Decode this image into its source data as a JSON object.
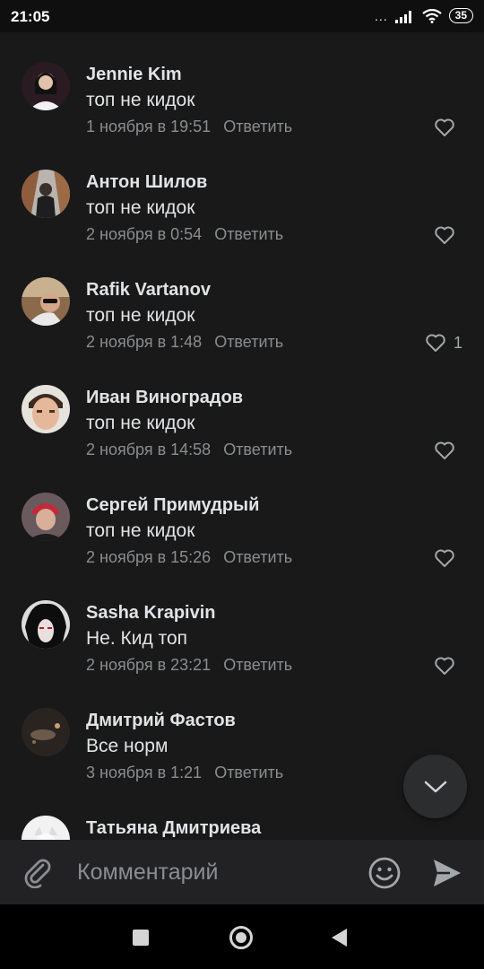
{
  "status_bar": {
    "time": "21:05",
    "signal_dots": "...",
    "battery": "35"
  },
  "comments": [
    {
      "author": "Jennie Kim",
      "text": "топ не кидок",
      "date": "1 ноября в 19:51",
      "reply": "Ответить",
      "likes": ""
    },
    {
      "author": "Антон Шилов",
      "text": "топ не кидок",
      "date": "2 ноября в 0:54",
      "reply": "Ответить",
      "likes": ""
    },
    {
      "author": "Rafik Vartanov",
      "text": "топ не кидок",
      "date": "2 ноября в 1:48",
      "reply": "Ответить",
      "likes": "1"
    },
    {
      "author": "Иван Виноградов",
      "text": "топ не кидок",
      "date": "2 ноября в 14:58",
      "reply": "Ответить",
      "likes": ""
    },
    {
      "author": "Сергей Примудрый",
      "text": "топ не кидок",
      "date": "2 ноября в 15:26",
      "reply": "Ответить",
      "likes": ""
    },
    {
      "author": "Sasha Krapivin",
      "text": "Не. Кид топ",
      "date": "2 ноября в 23:21",
      "reply": "Ответить",
      "likes": ""
    },
    {
      "author": "Дмитрий Фастов",
      "text": "Все норм",
      "date": "3 ноября в 1:21",
      "reply": "Ответить",
      "likes": ""
    },
    {
      "author": "Татьяна Дмитриева",
      "text": "",
      "date": "",
      "reply": "",
      "likes": ""
    }
  ],
  "input": {
    "placeholder": "Комментарий"
  },
  "colors": {
    "background": "#191919",
    "text": "#e1e3e6",
    "secondary": "#8a8d91",
    "input_bar": "#222224"
  },
  "icons": {
    "attach": "paperclip-icon",
    "emoji": "emoji-icon",
    "send": "send-icon",
    "like": "heart-icon",
    "scroll": "chevron-down-icon",
    "nav": [
      "recent-apps-icon",
      "home-icon",
      "back-icon"
    ]
  }
}
